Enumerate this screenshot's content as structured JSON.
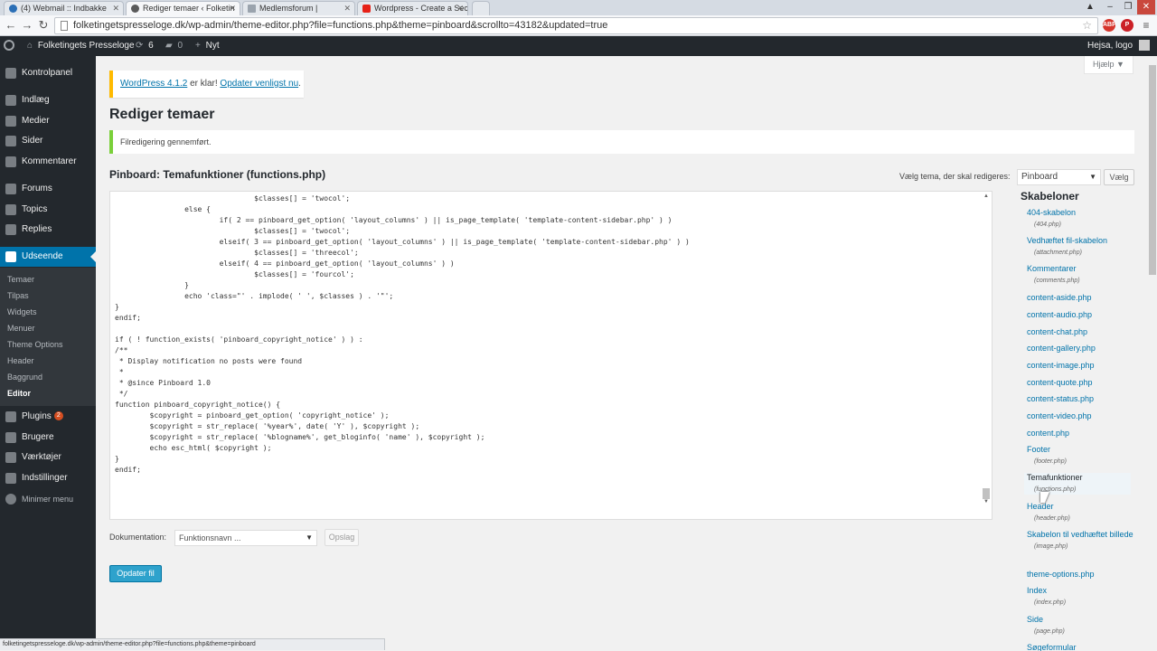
{
  "browser": {
    "tabs": [
      {
        "label": "(4) Webmail :: Indbakke",
        "favicon_color": "#2b6fb6"
      },
      {
        "label": "Rediger temaer ‹ Folketin",
        "favicon_color": "#5a5a5a"
      },
      {
        "label": "Medlemsforum |",
        "favicon_color": "#9aa3ad"
      },
      {
        "label": "Wordpress - Create a Sec",
        "favicon_color": "#e62117"
      },
      {
        "label": "",
        "favicon_color": ""
      }
    ],
    "url": "folketingetspresseloge.dk/wp-admin/theme-editor.php?file=functions.php&theme=pinboard&scrollto=43182&updated=true",
    "status_url": "folketingetspresseloge.dk/wp-admin/theme-editor.php?file=functions.php&theme=pinboard"
  },
  "adminbar": {
    "site_name": "Folketingets Presseloge",
    "updates_count": "6",
    "comments_count": "0",
    "new_label": "Nyt",
    "greeting": "Hejsa, logo"
  },
  "sidebar": {
    "items": [
      {
        "label": "Kontrolpanel"
      },
      {
        "label": "Indlæg"
      },
      {
        "label": "Medier"
      },
      {
        "label": "Sider"
      },
      {
        "label": "Kommentarer"
      },
      {
        "label": "Forums"
      },
      {
        "label": "Topics"
      },
      {
        "label": "Replies"
      },
      {
        "label": "Udseende"
      },
      {
        "label": "Plugins",
        "badge": "2"
      },
      {
        "label": "Brugere"
      },
      {
        "label": "Værktøjer"
      },
      {
        "label": "Indstillinger"
      },
      {
        "label": "Minimer menu"
      }
    ],
    "submenu": [
      "Temaer",
      "Tilpas",
      "Widgets",
      "Menuer",
      "Theme Options",
      "Header",
      "Baggrund",
      "Editor"
    ]
  },
  "main": {
    "help_label": "Hjælp ▼",
    "update_notice": {
      "link1": "WordPress 4.1.2",
      "middle": " er klar! ",
      "link2": "Opdater venligst nu",
      "end": "."
    },
    "page_title": "Rediger temaer",
    "success_message": "Filredigering gennemført.",
    "file_title": "Pinboard: Temafunktioner (functions.php)",
    "theme_select_label": "Vælg tema, der skal redigeres:",
    "theme_select_value": "Pinboard",
    "choose_button": "Vælg",
    "doc_label": "Dokumentation:",
    "doc_select_value": "Funktionsnavn ...",
    "lookup_button": "Opslag",
    "update_button": "Opdater fil"
  },
  "code": "\t\t\t\t$classes[] = 'twocol';\n\t\telse {\n\t\t\tif( 2 == pinboard_get_option( 'layout_columns' ) || is_page_template( 'template-content-sidebar.php' ) )\n\t\t\t\t$classes[] = 'twocol';\n\t\t\telseif( 3 == pinboard_get_option( 'layout_columns' ) || is_page_template( 'template-content-sidebar.php' ) )\n\t\t\t\t$classes[] = 'threecol';\n\t\t\telseif( 4 == pinboard_get_option( 'layout_columns' ) )\n\t\t\t\t$classes[] = 'fourcol';\n\t\t}\n\t\techo 'class=\"' . implode( ' ', $classes ) . '\"';\n}\nendif;\n\nif ( ! function_exists( 'pinboard_copyright_notice' ) ) :\n/**\n * Display notification no posts were found\n *\n * @since Pinboard 1.0\n */\nfunction pinboard_copyright_notice() {\n\t$copyright = pinboard_get_option( 'copyright_notice' );\n\t$copyright = str_replace( '%year%', date( 'Y' ), $copyright );\n\t$copyright = str_replace( '%blogname%', get_bloginfo( 'name' ), $copyright );\n\techo esc_html( $copyright );\n}\nendif;",
  "templates": {
    "heading": "Skabeloner",
    "items": [
      {
        "name": "404-skabelon",
        "file": "(404.php)"
      },
      {
        "name": "Vedhæftet fil-skabelon",
        "file": "(attachment.php)"
      },
      {
        "name": "Kommentarer",
        "file": "(comments.php)"
      },
      {
        "name": "content-aside.php",
        "file": ""
      },
      {
        "name": "content-audio.php",
        "file": ""
      },
      {
        "name": "content-chat.php",
        "file": ""
      },
      {
        "name": "content-gallery.php",
        "file": ""
      },
      {
        "name": "content-image.php",
        "file": ""
      },
      {
        "name": "content-quote.php",
        "file": ""
      },
      {
        "name": "content-status.php",
        "file": ""
      },
      {
        "name": "content-video.php",
        "file": ""
      },
      {
        "name": "content.php",
        "file": ""
      },
      {
        "name": "Footer",
        "file": "(footer.php)"
      },
      {
        "name": "Temafunktioner",
        "file": "(functions.php)"
      },
      {
        "name": "Header",
        "file": "(header.php)"
      },
      {
        "name": "Skabelon til vedhæftet billede",
        "file": "(image.php)"
      },
      {
        "name": "theme-options.php",
        "file": ""
      },
      {
        "name": "Index",
        "file": "(index.php)"
      },
      {
        "name": "Side",
        "file": "(page.php)"
      },
      {
        "name": "Søgeformular",
        "file": ""
      }
    ]
  },
  "colors": {
    "admin_bar": "#23282d",
    "accent": "#0073aa",
    "primary_button": "#2ea2cc",
    "warning": "#ffba00",
    "success": "#7ad03a"
  }
}
